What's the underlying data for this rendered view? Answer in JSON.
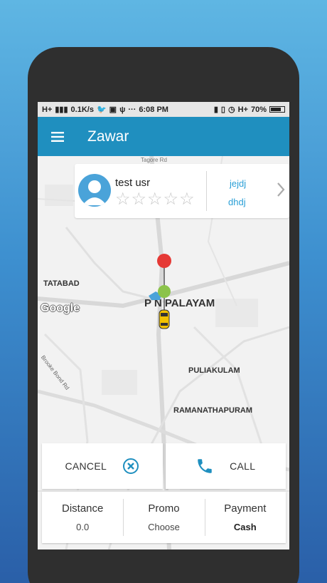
{
  "status_bar": {
    "network": "H+",
    "speed": "0.1K/s",
    "time": "6:08 PM",
    "right_network": "H+",
    "battery": "70%"
  },
  "app_bar": {
    "title": "Zawar",
    "menu_icon": "hamburger-menu-icon"
  },
  "map": {
    "labels": {
      "tagore": "Tagore Rd",
      "tatabad": "TATABAD",
      "pn_palayam": "P N PALAYAM",
      "brooke": "Brooke Bond Rd",
      "puliakulam": "PULIAKULAM",
      "ramanathapuram": "RAMANATHAPURAM"
    },
    "google_logo": "Google",
    "markers": [
      "pickup-pin-red",
      "drop-pin-green",
      "car-yellow"
    ]
  },
  "driver_card": {
    "name": "test usr",
    "rating": 0,
    "max_rating": 5,
    "vehicle_line1": "jejdj",
    "vehicle_line2": "dhdj"
  },
  "actions": {
    "cancel_label": "CANCEL",
    "call_label": "CALL"
  },
  "summary": {
    "distance_title": "Distance",
    "distance_value": "0.0",
    "promo_title": "Promo",
    "promo_value": "Choose",
    "payment_title": "Payment",
    "payment_value": "Cash"
  },
  "colors": {
    "app_bar": "#1f8fbf",
    "accent": "#2a9fd6",
    "pickup": "#e53935",
    "drop": "#8bc34a",
    "car": "#f2c200"
  }
}
